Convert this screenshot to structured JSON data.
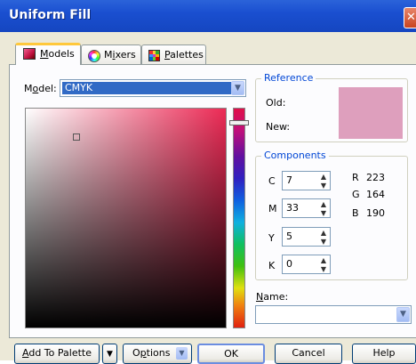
{
  "window": {
    "title": "Uniform Fill"
  },
  "tabs": [
    {
      "label": "Models",
      "icon": "color-square-icon",
      "active": true
    },
    {
      "label": "Mixers",
      "icon": "color-wheel-icon"
    },
    {
      "label": "Palettes",
      "icon": "palette-grid-icon"
    }
  ],
  "model": {
    "label": "Model:",
    "value": "CMYK"
  },
  "reference": {
    "title": "Reference",
    "old_label": "Old:",
    "new_label": "New:",
    "new_color": "#de9fbd"
  },
  "components": {
    "title": "Components",
    "cmyk": [
      {
        "label": "C",
        "value": "7"
      },
      {
        "label": "M",
        "value": "33"
      },
      {
        "label": "Y",
        "value": "5"
      },
      {
        "label": "K",
        "value": "0"
      }
    ],
    "rgb": [
      {
        "label": "R",
        "value": "223"
      },
      {
        "label": "G",
        "value": "164"
      },
      {
        "label": "B",
        "value": "190"
      }
    ]
  },
  "name": {
    "label": "Name:",
    "value": ""
  },
  "buttons": {
    "add_to_palette": "Add To Palette",
    "options": "Options",
    "ok": "OK",
    "cancel": "Cancel",
    "help": "Help"
  },
  "colors": {
    "hue": "#ec2a55",
    "titlebar": "#1a4fd0",
    "group_title": "#0046d5"
  }
}
